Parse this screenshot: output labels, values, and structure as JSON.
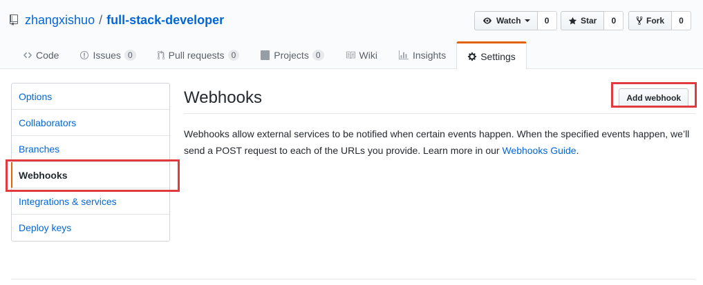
{
  "repo": {
    "owner": "zhangxishuo",
    "separator": "/",
    "name": "full-stack-developer",
    "icon": "repo-icon"
  },
  "actions": {
    "watch_label": "Watch",
    "watch_count": "0",
    "star_label": "Star",
    "star_count": "0",
    "fork_label": "Fork",
    "fork_count": "0"
  },
  "tabs": [
    {
      "label": "Code",
      "icon": "code-icon"
    },
    {
      "label": "Issues",
      "counter": "0",
      "icon": "issue-icon"
    },
    {
      "label": "Pull requests",
      "counter": "0",
      "icon": "pull-request-icon"
    },
    {
      "label": "Projects",
      "counter": "0",
      "icon": "project-icon"
    },
    {
      "label": "Wiki",
      "icon": "book-icon"
    },
    {
      "label": "Insights",
      "icon": "graph-icon"
    },
    {
      "label": "Settings",
      "icon": "gear-icon",
      "selected": true
    }
  ],
  "menu": [
    {
      "label": "Options"
    },
    {
      "label": "Collaborators"
    },
    {
      "label": "Branches"
    },
    {
      "label": "Webhooks",
      "active": true
    },
    {
      "label": "Integrations & services"
    },
    {
      "label": "Deploy keys"
    }
  ],
  "main": {
    "title": "Webhooks",
    "add_button": "Add webhook",
    "description_text": "Webhooks allow external services to be notified when certain events happen. When the specified events happen, we’ll send a POST request to each of the URLs you provide. Learn more in our",
    "description_link": "Webhooks Guide",
    "description_end": "."
  },
  "colors": {
    "link": "#0366d6",
    "accent": "#e36209",
    "highlight": "#e0393e"
  }
}
